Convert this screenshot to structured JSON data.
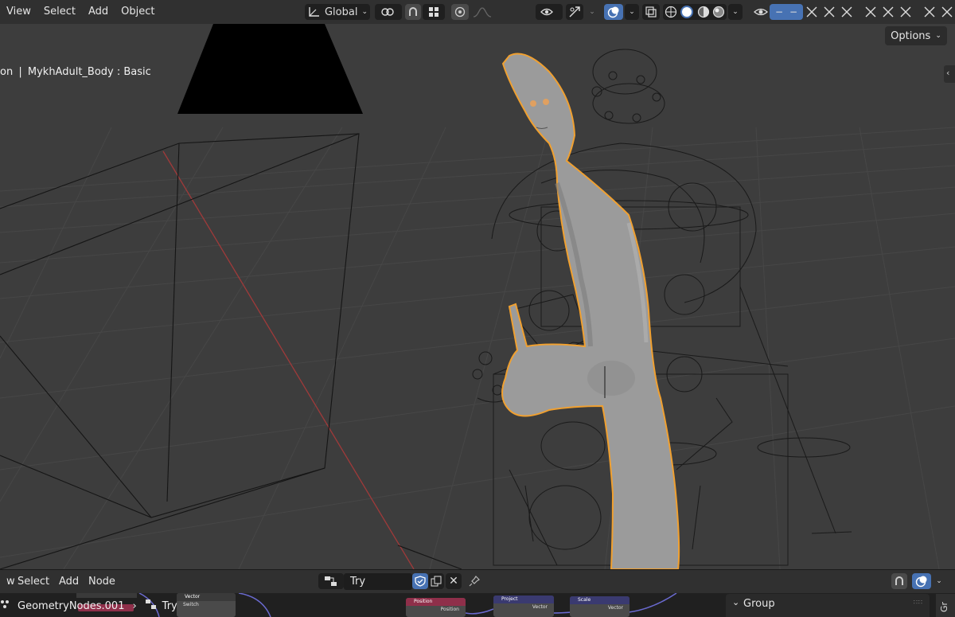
{
  "viewport_header": {
    "menus": [
      "View",
      "Select",
      "Add",
      "Object"
    ],
    "transform_orientation": "Global",
    "options_label": "Options"
  },
  "viewport": {
    "mode_label_prefix": "on",
    "object_label": "MykhAdult_Body : Basic"
  },
  "node_editor": {
    "menus": [
      "w",
      "Select",
      "Add",
      "Node"
    ],
    "node_tree_name": "Try",
    "breadcrumb": {
      "modifier": "GeometryNodes.001",
      "tree": "Try"
    },
    "group_panel_title": "Group",
    "right_tab_label": "Gr",
    "nodes": [
      {
        "title": "Vector",
        "socket": "Switch"
      },
      {
        "title": "Position",
        "socket": "Position"
      },
      {
        "title": "Project",
        "socket": "Vector"
      },
      {
        "title": "Scale",
        "socket": "Vector"
      }
    ]
  },
  "colors": {
    "accent": "#4772b3",
    "selection_outline": "#f0a030",
    "node_position_header": "#8f2f4a",
    "node_vector_header": "#3a3a70",
    "node_group_header": "#8f2f4a"
  }
}
